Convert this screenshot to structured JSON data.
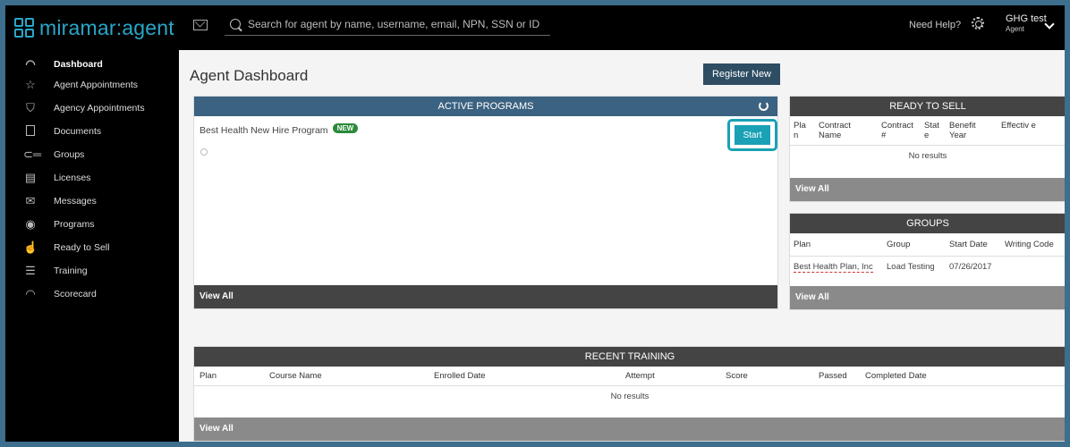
{
  "app": {
    "logo_text": "miramar:agent",
    "search_placeholder": "Search for agent by name, username, email, NPN, SSN or ID",
    "help_label": "Need Help?",
    "user_name": "GHG test",
    "user_role": "Agent"
  },
  "sidebar": {
    "items": [
      {
        "label": "Dashboard",
        "icon": "speedometer-icon",
        "active": true
      },
      {
        "label": "Agent Appointments",
        "icon": "star-icon"
      },
      {
        "label": "Agency Appointments",
        "icon": "shield-star-icon"
      },
      {
        "label": "Documents",
        "icon": "document-icon"
      },
      {
        "label": "Groups",
        "icon": "key-icon"
      },
      {
        "label": "Licenses",
        "icon": "license-icon"
      },
      {
        "label": "Messages",
        "icon": "mail-icon"
      },
      {
        "label": "Programs",
        "icon": "eye-icon"
      },
      {
        "label": "Ready to Sell",
        "icon": "thumbs-up-icon"
      },
      {
        "label": "Training",
        "icon": "checklist-icon"
      },
      {
        "label": "Scorecard",
        "icon": "gauge-icon"
      }
    ]
  },
  "main": {
    "title": "Agent Dashboard",
    "register_label": "Register New",
    "active_programs": {
      "header": "ACTIVE PROGRAMS",
      "program_name": "Best Health New Hire Program",
      "badge": "NEW",
      "start_label": "Start",
      "view_all": "View All"
    },
    "ready_to_sell": {
      "header": "READY TO SELL",
      "columns": [
        "Pla n",
        "Contract Name",
        "Contract #",
        "Stat e",
        "Benefit Year",
        "Effectiv e"
      ],
      "empty": "No results",
      "view_all": "View All"
    },
    "groups": {
      "header": "GROUPS",
      "columns": [
        "Plan",
        "Group",
        "Start Date",
        "Writing Code"
      ],
      "rows": [
        [
          "Best Health Plan, Inc",
          "Load Testing",
          "07/26/2017",
          ""
        ]
      ],
      "view_all": "View All"
    },
    "recent_training": {
      "header": "RECENT TRAINING",
      "columns": [
        "Plan",
        "Course Name",
        "Enrolled Date",
        "Attempt",
        "Score",
        "Passed",
        "Completed Date"
      ],
      "empty": "No results",
      "view_all": "View All"
    }
  }
}
